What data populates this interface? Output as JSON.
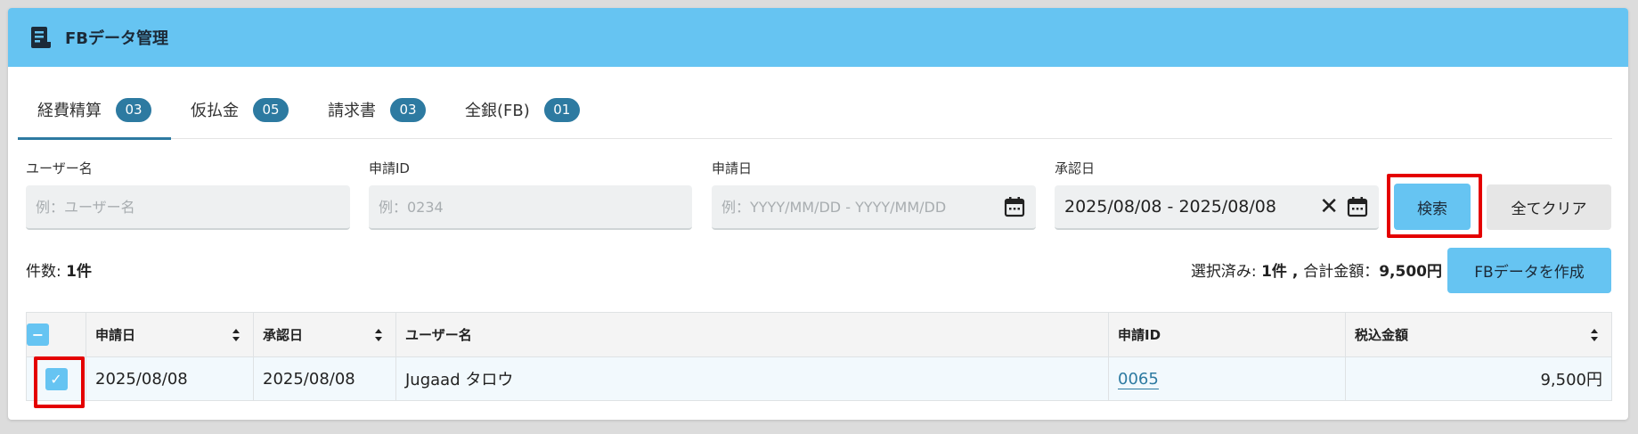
{
  "header": {
    "title": "FBデータ管理",
    "icon": "document-icon"
  },
  "tabs": [
    {
      "label": "経費精算",
      "count": "03",
      "active": true
    },
    {
      "label": "仮払金",
      "count": "05",
      "active": false
    },
    {
      "label": "請求書",
      "count": "03",
      "active": false
    },
    {
      "label": "全銀(FB)",
      "count": "01",
      "active": false
    }
  ],
  "filters": {
    "user_name": {
      "label": "ユーザー名",
      "placeholder": "例：ユーザー名",
      "value": ""
    },
    "request_id": {
      "label": "申請ID",
      "placeholder": "例：0234",
      "value": ""
    },
    "request_date": {
      "label": "申請日",
      "placeholder": "例：YYYY/MM/DD - YYYY/MM/DD",
      "value": ""
    },
    "approval_date": {
      "label": "承認日",
      "placeholder": "",
      "value": "2025/08/08 - 2025/08/08"
    }
  },
  "buttons": {
    "search": "検索",
    "clear_all": "全てクリア",
    "create_fb": "FBデータを作成"
  },
  "count": {
    "label": "件数: ",
    "value": "1件"
  },
  "summary": {
    "selected_label": "選択済み: ",
    "selected_value": "1件",
    "separator": " , ",
    "total_label": "合計金額：",
    "total_value": "9,500円"
  },
  "table": {
    "headers": [
      "申請日",
      "承認日",
      "ユーザー名",
      "申請ID",
      "税込金額"
    ],
    "rows": [
      {
        "request_date": "2025/08/08",
        "approval_date": "2025/08/08",
        "user_name": "Jugaad タロウ",
        "request_id": "0065",
        "amount": "9,500円",
        "checked": true
      }
    ]
  },
  "colors": {
    "header_bg": "#66c4f2",
    "accent": "#2d7aa1",
    "highlight": "#e40000"
  }
}
